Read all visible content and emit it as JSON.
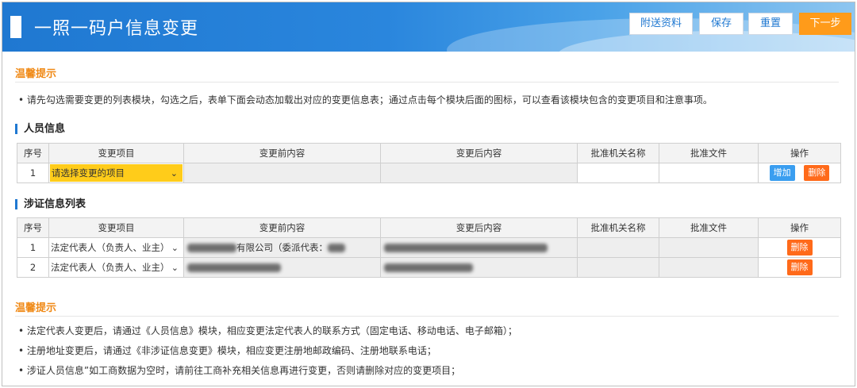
{
  "header": {
    "title": "一照一码户信息变更",
    "buttons": [
      {
        "label": "附送资料"
      },
      {
        "label": "保存"
      },
      {
        "label": "重置"
      },
      {
        "label": "下一步"
      }
    ],
    "colors": {
      "accent": "#1f78d1",
      "primary_button": "#ff9b1a"
    }
  },
  "tips_top": {
    "title": "温馨提示",
    "lines": [
      "• 请先勾选需要变更的列表模块，勾选之后，表单下面会动态加载出对应的变更信息表；通过点击每个模块后面的图标，可以查看该模块包含的变更项目和注意事项。"
    ]
  },
  "personnel": {
    "section_title": "人员信息",
    "columns": [
      "序号",
      "变更项目",
      "变更前内容",
      "变更后内容",
      "批准机关名称",
      "批准文件",
      "操作"
    ],
    "rows": [
      {
        "index": "1",
        "item": "请选择变更的项目",
        "add_label": "增加",
        "delete_label": "删除"
      }
    ]
  },
  "license": {
    "section_title": "涉证信息列表",
    "columns": [
      "序号",
      "变更项目",
      "变更前内容",
      "变更后内容",
      "批准机关名称",
      "批准文件",
      "操作"
    ],
    "rows": [
      {
        "index": "1",
        "item": "法定代表人（负责人、业主）",
        "before_text": "有限公司（委派代表：",
        "delete_label": "删除"
      },
      {
        "index": "2",
        "item": "法定代表人（负责人、业主）",
        "delete_label": "删除"
      }
    ]
  },
  "tips_bottom": {
    "title": "温馨提示",
    "lines": [
      "• 法定代表人变更后，请通过《人员信息》模块，相应变更法定代表人的联系方式（固定电话、移动电话、电子邮箱）；",
      "• 注册地址变更后，请通过《非涉证信息变更》模块，相应变更注册地邮政编码、注册地联系电话；",
      "• 涉证人员信息”如工商数据为空时，请前往工商补充相关信息再进行变更，否则请删除对应的变更项目；"
    ]
  }
}
